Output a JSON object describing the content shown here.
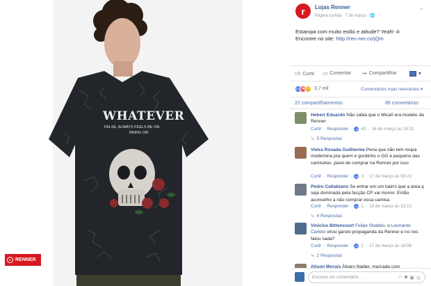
{
  "photo": {
    "badge_text": "RENNER",
    "shirt_headline": "WHATEVER",
    "shirt_subline": "FALSE, ALWAYS FEELS BE ON",
    "shirt_subline2": "BRING ON"
  },
  "post": {
    "logo_letter": "r",
    "page_name": "Lojas Renner",
    "meta": "Página curtida · 7 de março · 🌐",
    "chevron": "⌄",
    "caption_line1": "Estampa com muito estilo e atitude? Yeah! ☠",
    "caption_line2_prefix": "Encontre no site: ",
    "caption_link": "http://ren-ner.co/jQm"
  },
  "actions": {
    "like_label": "Curtir",
    "comment_label": "Comentar",
    "share_label": "Compartilhar"
  },
  "reactions": {
    "count": "3,7 mil",
    "order_label": "Comentários mais relevantes ▾"
  },
  "stats": {
    "shares": "22 compartilhamentos",
    "comments": "86 comentários"
  },
  "comments": [
    {
      "author": "Hebert Eduardo",
      "text": " Não sabia que o Mica0 era modelo da Renner",
      "like": "Curtir",
      "reply": "Responder",
      "likes": "42",
      "time": "16 de março às 14:31",
      "replies": "5 Respostas"
    },
    {
      "author": "Vieira Rosada Guilherme",
      "text": " Pena que não tem roupa modernina pra quem e gordinho o GG é pequeno das camisetas ,parei de comprar na Renner por isso",
      "like": "Curtir",
      "reply": "Responder",
      "likes": "3",
      "time": "17 de março às 09:22",
      "replies": ""
    },
    {
      "author": "Pedro Caltabiano",
      "text": " Se entrar em um bairro que a área q seja dominada pela facção CP vai morrer. Então aconselho a não comprar essa camisa.",
      "like": "Curtir",
      "reply": "Responder",
      "likes": "1",
      "time": "15 de março às 23:13",
      "replies": "4 Respostas"
    },
    {
      "author": "Vinicius Bittencourt",
      "tag1": "Felipe Sbabbo",
      "mid": ", o ",
      "tag2": "Leonardo Carleto",
      "text": " virou garoto propaganda da Renner e no nos falou nada?",
      "like": "Curtir",
      "reply": "Responder",
      "likes": "2",
      "time": "17 de março às 16:06",
      "replies": "2 Respostas"
    },
    {
      "author": "Alison Morais",
      "text": " Álvaro Nadjer, marcada com"
    }
  ],
  "composer": {
    "placeholder": "Escreva um comentário..."
  },
  "colors": {
    "brand_red": "#d71920",
    "link_blue": "#365899"
  }
}
